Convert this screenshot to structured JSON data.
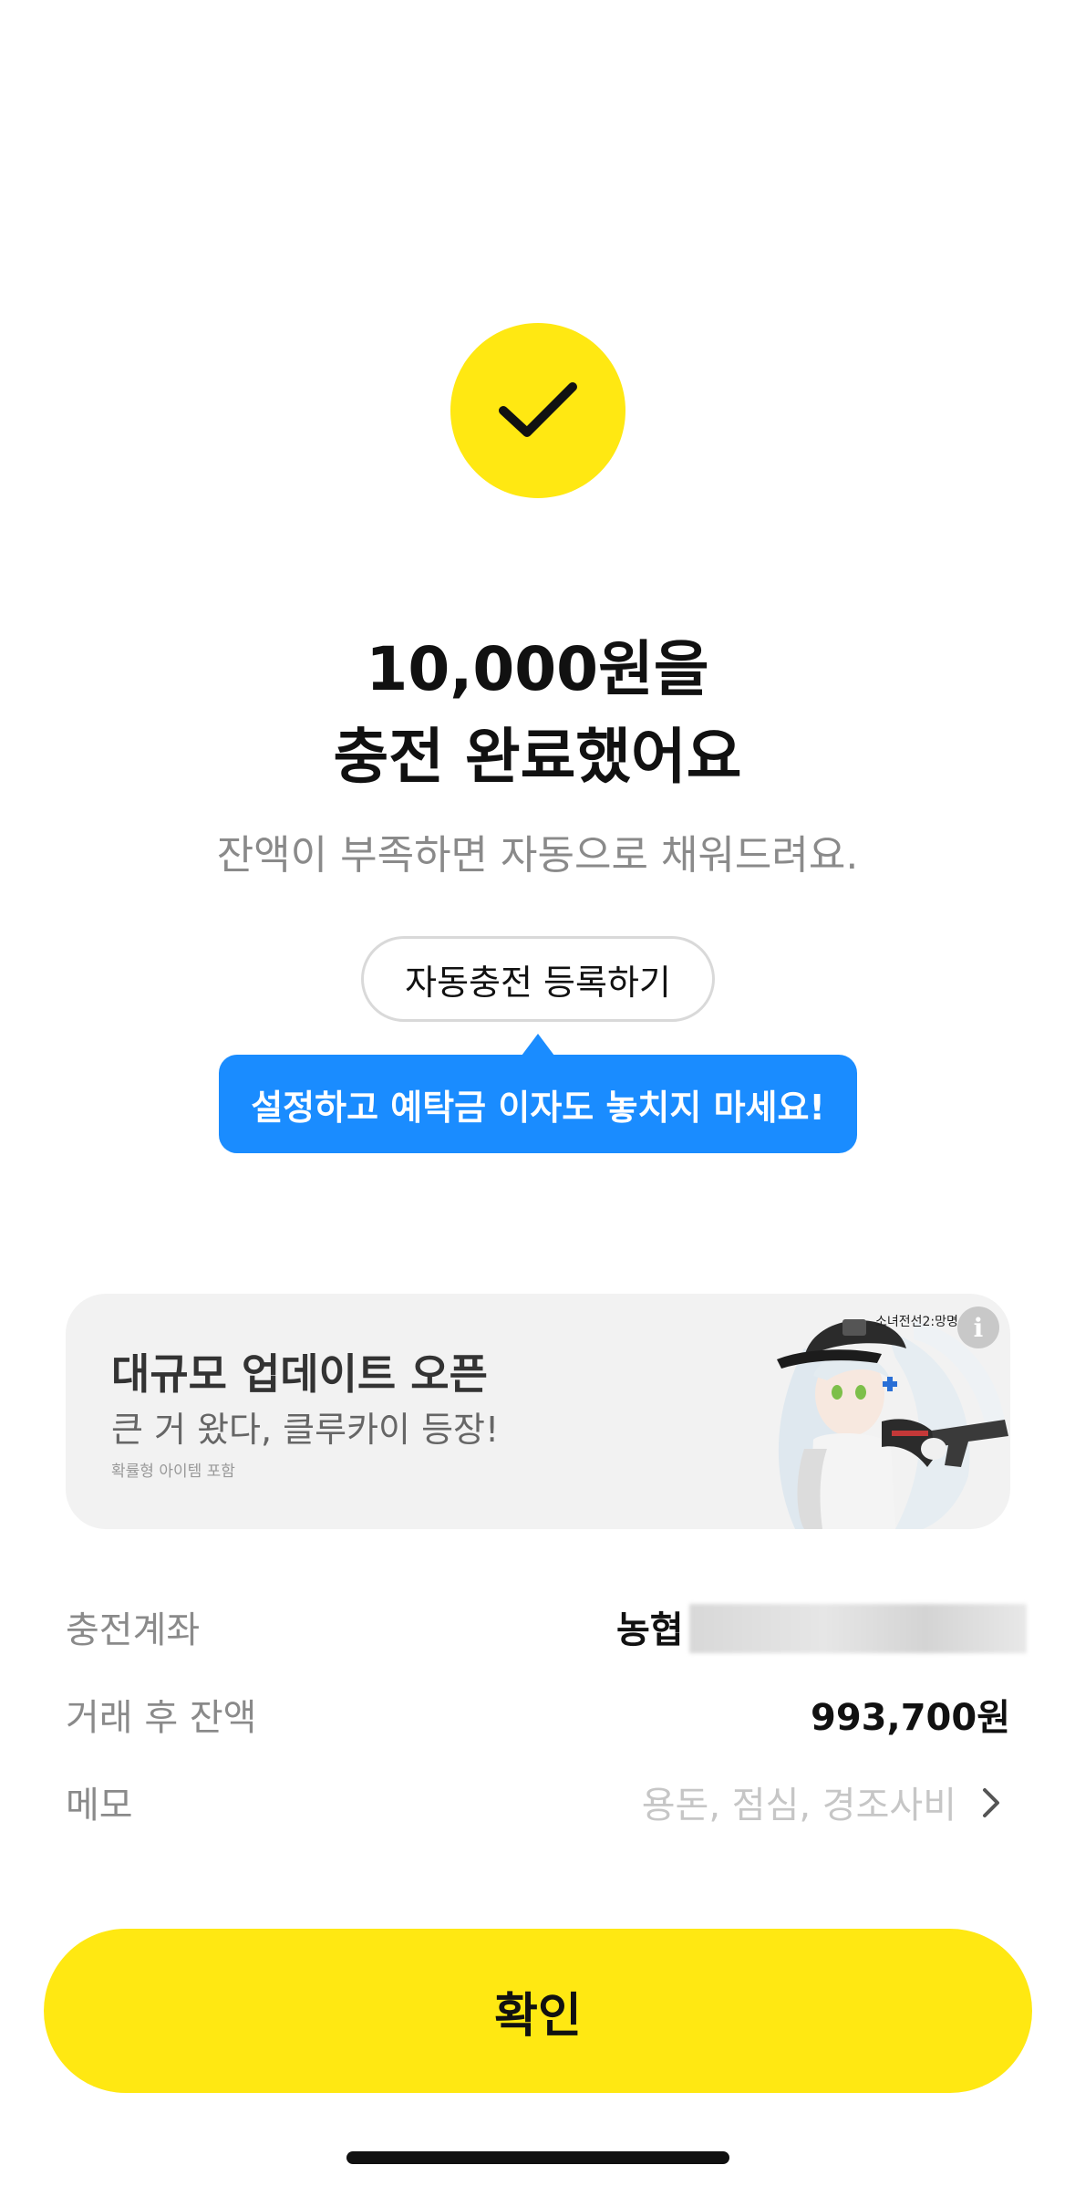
{
  "status": {
    "check_icon": "checkmark-icon",
    "accent_color": "#ffe812"
  },
  "result": {
    "title_line1": "10,000원을",
    "title_line2": "충전 완료했어요",
    "subtitle": "잔액이 부족하면 자동으로 채워드려요."
  },
  "auto_charge": {
    "button_label": "자동충전 등록하기",
    "tooltip": "설정하고 예탁금 이자도 놓치지 마세요!",
    "tooltip_color": "#1a8cff"
  },
  "banner": {
    "title": "대규모 업데이트 오픈",
    "subtitle": "큰 거 왔다, 클루카이 등장!",
    "note": "확률형 아이템 포함",
    "logo_text": "소녀전선2:망명",
    "info_icon": "info-icon"
  },
  "details": {
    "account_label": "충전계좌",
    "account_bank": "농협",
    "balance_label": "거래 후 잔액",
    "balance_value": "993,700원",
    "memo_label": "메모",
    "memo_placeholder": "용돈, 점심, 경조사비"
  },
  "footer": {
    "confirm_label": "확인"
  }
}
